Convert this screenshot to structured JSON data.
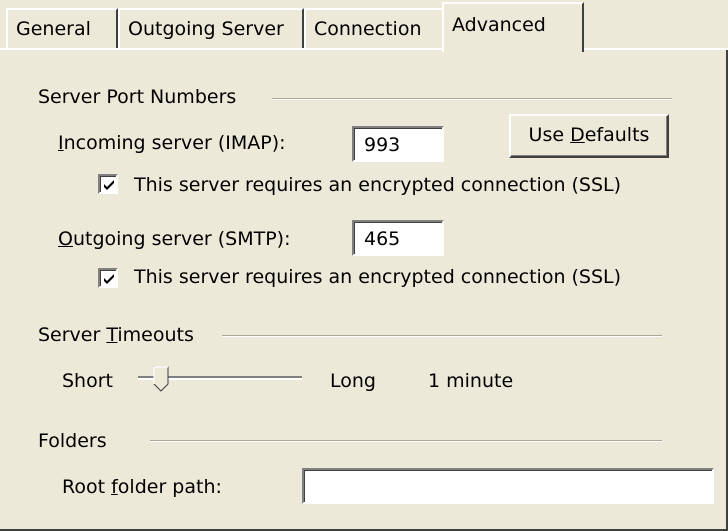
{
  "tabs": [
    {
      "label": "General"
    },
    {
      "label": "Outgoing Server"
    },
    {
      "label": "Connection"
    },
    {
      "label": "Advanced",
      "active": true
    }
  ],
  "ports": {
    "group_title": "Server Port Numbers",
    "incoming": {
      "label_prefix": "",
      "label_mnemonic": "I",
      "label_rest": "ncoming server (IMAP):",
      "value": "993",
      "ssl_checked": true,
      "ssl_label": "This server requires an encrypted connection (SSL)"
    },
    "outgoing": {
      "label_prefix": "",
      "label_mnemonic": "O",
      "label_rest": "utgoing server (SMTP):",
      "value": "465",
      "ssl_checked": true,
      "ssl_label": "This server requires an encrypted connection (SSL)"
    },
    "defaults_button": {
      "prefix": "Use ",
      "mnemonic": "D",
      "rest": "efaults"
    }
  },
  "timeouts": {
    "group_title_prefix": "Server ",
    "group_title_mnemonic": "T",
    "group_title_rest": "imeouts",
    "short_label": "Short",
    "long_label": "Long",
    "value_text": "1 minute",
    "slider_level": 0.1
  },
  "folders": {
    "group_title": "Folders",
    "root_label_prefix": "Root ",
    "root_label_mnemonic": "f",
    "root_label_rest": "older path:",
    "root_value": ""
  },
  "colors": {
    "face": "#ece9d8",
    "shadow": "#808080",
    "dark_shadow": "#404040",
    "highlight": "#ffffff"
  }
}
